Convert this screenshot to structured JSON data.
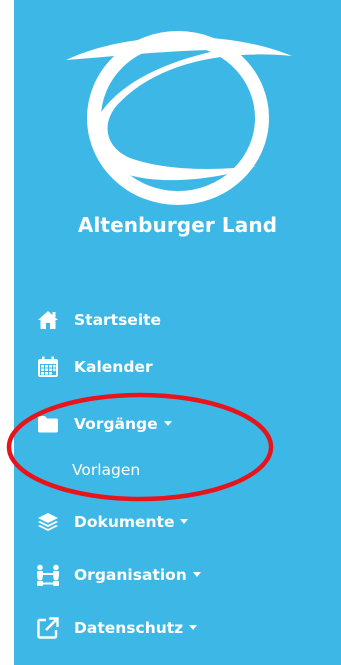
{
  "brand": {
    "name": "Altenburger Land"
  },
  "nav": {
    "items": [
      {
        "label": "Startseite",
        "icon": "home-icon",
        "dropdown": false
      },
      {
        "label": "Kalender",
        "icon": "calendar-icon",
        "dropdown": false
      },
      {
        "label": "Vorgänge",
        "icon": "folder-icon",
        "dropdown": true
      },
      {
        "label": "Dokumente",
        "icon": "layers-icon",
        "dropdown": true
      },
      {
        "label": "Organisation",
        "icon": "sitemap-icon",
        "dropdown": true
      },
      {
        "label": "Datenschutz",
        "icon": "external-link-icon",
        "dropdown": true
      }
    ],
    "vorgaenge_sub": [
      {
        "label": "Vorlagen"
      }
    ]
  },
  "colors": {
    "sidebar_bg": "#3db8e6",
    "text": "#ffffff",
    "highlight": "#e8141c"
  }
}
